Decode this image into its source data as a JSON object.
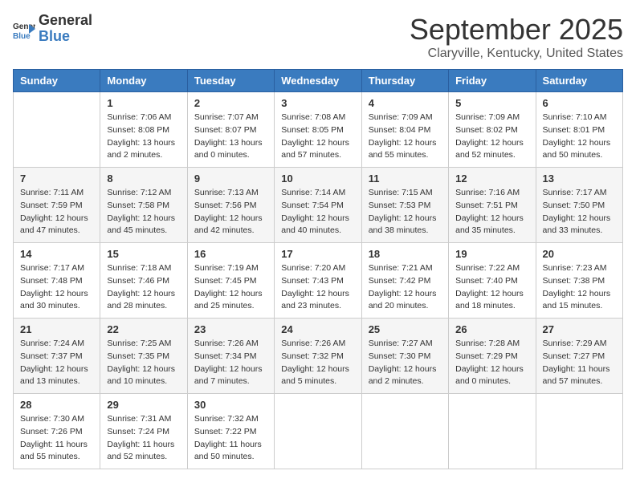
{
  "logo": {
    "text_general": "General",
    "text_blue": "Blue"
  },
  "header": {
    "month": "September 2025",
    "location": "Claryville, Kentucky, United States"
  },
  "weekdays": [
    "Sunday",
    "Monday",
    "Tuesday",
    "Wednesday",
    "Thursday",
    "Friday",
    "Saturday"
  ],
  "weeks": [
    [
      {
        "day": "",
        "info": ""
      },
      {
        "day": "1",
        "info": "Sunrise: 7:06 AM\nSunset: 8:08 PM\nDaylight: 13 hours\nand 2 minutes."
      },
      {
        "day": "2",
        "info": "Sunrise: 7:07 AM\nSunset: 8:07 PM\nDaylight: 13 hours\nand 0 minutes."
      },
      {
        "day": "3",
        "info": "Sunrise: 7:08 AM\nSunset: 8:05 PM\nDaylight: 12 hours\nand 57 minutes."
      },
      {
        "day": "4",
        "info": "Sunrise: 7:09 AM\nSunset: 8:04 PM\nDaylight: 12 hours\nand 55 minutes."
      },
      {
        "day": "5",
        "info": "Sunrise: 7:09 AM\nSunset: 8:02 PM\nDaylight: 12 hours\nand 52 minutes."
      },
      {
        "day": "6",
        "info": "Sunrise: 7:10 AM\nSunset: 8:01 PM\nDaylight: 12 hours\nand 50 minutes."
      }
    ],
    [
      {
        "day": "7",
        "info": "Sunrise: 7:11 AM\nSunset: 7:59 PM\nDaylight: 12 hours\nand 47 minutes."
      },
      {
        "day": "8",
        "info": "Sunrise: 7:12 AM\nSunset: 7:58 PM\nDaylight: 12 hours\nand 45 minutes."
      },
      {
        "day": "9",
        "info": "Sunrise: 7:13 AM\nSunset: 7:56 PM\nDaylight: 12 hours\nand 42 minutes."
      },
      {
        "day": "10",
        "info": "Sunrise: 7:14 AM\nSunset: 7:54 PM\nDaylight: 12 hours\nand 40 minutes."
      },
      {
        "day": "11",
        "info": "Sunrise: 7:15 AM\nSunset: 7:53 PM\nDaylight: 12 hours\nand 38 minutes."
      },
      {
        "day": "12",
        "info": "Sunrise: 7:16 AM\nSunset: 7:51 PM\nDaylight: 12 hours\nand 35 minutes."
      },
      {
        "day": "13",
        "info": "Sunrise: 7:17 AM\nSunset: 7:50 PM\nDaylight: 12 hours\nand 33 minutes."
      }
    ],
    [
      {
        "day": "14",
        "info": "Sunrise: 7:17 AM\nSunset: 7:48 PM\nDaylight: 12 hours\nand 30 minutes."
      },
      {
        "day": "15",
        "info": "Sunrise: 7:18 AM\nSunset: 7:46 PM\nDaylight: 12 hours\nand 28 minutes."
      },
      {
        "day": "16",
        "info": "Sunrise: 7:19 AM\nSunset: 7:45 PM\nDaylight: 12 hours\nand 25 minutes."
      },
      {
        "day": "17",
        "info": "Sunrise: 7:20 AM\nSunset: 7:43 PM\nDaylight: 12 hours\nand 23 minutes."
      },
      {
        "day": "18",
        "info": "Sunrise: 7:21 AM\nSunset: 7:42 PM\nDaylight: 12 hours\nand 20 minutes."
      },
      {
        "day": "19",
        "info": "Sunrise: 7:22 AM\nSunset: 7:40 PM\nDaylight: 12 hours\nand 18 minutes."
      },
      {
        "day": "20",
        "info": "Sunrise: 7:23 AM\nSunset: 7:38 PM\nDaylight: 12 hours\nand 15 minutes."
      }
    ],
    [
      {
        "day": "21",
        "info": "Sunrise: 7:24 AM\nSunset: 7:37 PM\nDaylight: 12 hours\nand 13 minutes."
      },
      {
        "day": "22",
        "info": "Sunrise: 7:25 AM\nSunset: 7:35 PM\nDaylight: 12 hours\nand 10 minutes."
      },
      {
        "day": "23",
        "info": "Sunrise: 7:26 AM\nSunset: 7:34 PM\nDaylight: 12 hours\nand 7 minutes."
      },
      {
        "day": "24",
        "info": "Sunrise: 7:26 AM\nSunset: 7:32 PM\nDaylight: 12 hours\nand 5 minutes."
      },
      {
        "day": "25",
        "info": "Sunrise: 7:27 AM\nSunset: 7:30 PM\nDaylight: 12 hours\nand 2 minutes."
      },
      {
        "day": "26",
        "info": "Sunrise: 7:28 AM\nSunset: 7:29 PM\nDaylight: 12 hours\nand 0 minutes."
      },
      {
        "day": "27",
        "info": "Sunrise: 7:29 AM\nSunset: 7:27 PM\nDaylight: 11 hours\nand 57 minutes."
      }
    ],
    [
      {
        "day": "28",
        "info": "Sunrise: 7:30 AM\nSunset: 7:26 PM\nDaylight: 11 hours\nand 55 minutes."
      },
      {
        "day": "29",
        "info": "Sunrise: 7:31 AM\nSunset: 7:24 PM\nDaylight: 11 hours\nand 52 minutes."
      },
      {
        "day": "30",
        "info": "Sunrise: 7:32 AM\nSunset: 7:22 PM\nDaylight: 11 hours\nand 50 minutes."
      },
      {
        "day": "",
        "info": ""
      },
      {
        "day": "",
        "info": ""
      },
      {
        "day": "",
        "info": ""
      },
      {
        "day": "",
        "info": ""
      }
    ]
  ]
}
